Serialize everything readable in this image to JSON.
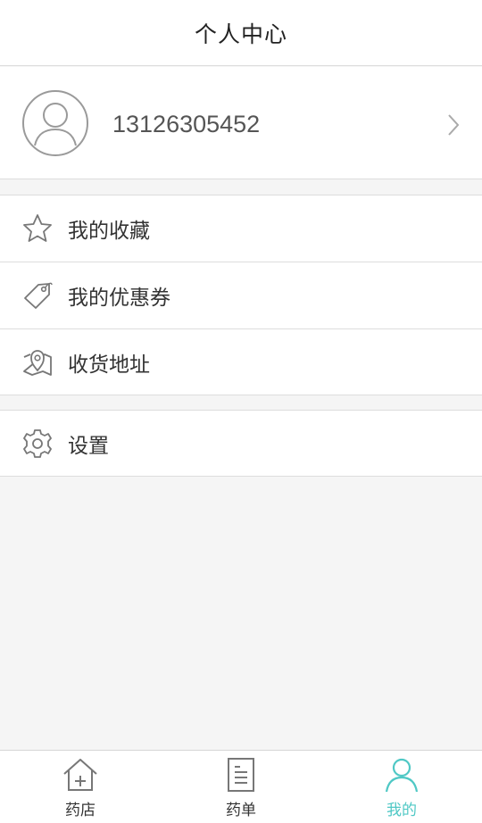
{
  "header": {
    "title": "个人中心"
  },
  "profile": {
    "phone": "13126305452"
  },
  "menu_group1": [
    {
      "icon": "star-icon",
      "label": "我的收藏"
    },
    {
      "icon": "tag-icon",
      "label": "我的优惠券"
    },
    {
      "icon": "map-pin-icon",
      "label": "收货地址"
    }
  ],
  "menu_group2": [
    {
      "icon": "gear-icon",
      "label": "设置"
    }
  ],
  "tabbar": {
    "items": [
      {
        "icon": "home-plus-icon",
        "label": "药店",
        "active": false
      },
      {
        "icon": "document-icon",
        "label": "药单",
        "active": false
      },
      {
        "icon": "user-icon",
        "label": "我的",
        "active": true
      }
    ],
    "active_color": "#4fc8c5"
  }
}
